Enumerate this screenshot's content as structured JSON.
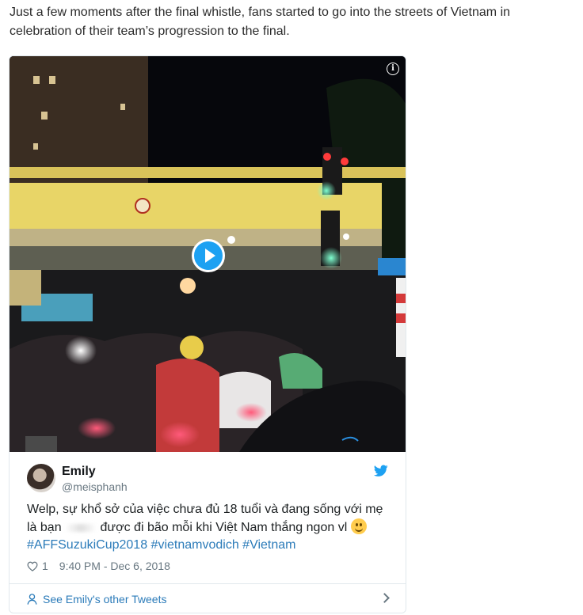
{
  "article": {
    "paragraph": "Just a few moments after the final whistle, fans started to go into the streets of Vietnam in celebration of their team’s progression to the final."
  },
  "video": {
    "info_icon": "info-icon",
    "play_icon": "play-icon"
  },
  "tweet": {
    "user_name": "Emily",
    "user_handle": "@meisphanh",
    "text_line1": "Welp, sự khổ sở của việc chưa đủ 18 tuổi và đang sống với mẹ",
    "text_line2_start": "là bạn",
    "text_line2_end": "được đi bão mỗi khi Việt Nam thắng ngon vl",
    "hashtags": [
      "#AFFSuzukiCup2018",
      "#vietnamvodich",
      "#Vietnam"
    ],
    "likes": "1",
    "timestamp": "9:40 PM - Dec 6, 2018",
    "see_more": "See Emily's other Tweets",
    "icons": {
      "brand": "twitter-bird-icon",
      "like": "heart-icon",
      "person": "person-icon",
      "emoji": "smile-emoji-icon",
      "more": "chevron-right-icon"
    }
  },
  "colors": {
    "twitter_blue": "#1da1f2",
    "link": "#2b7bb9",
    "muted": "#697882"
  }
}
